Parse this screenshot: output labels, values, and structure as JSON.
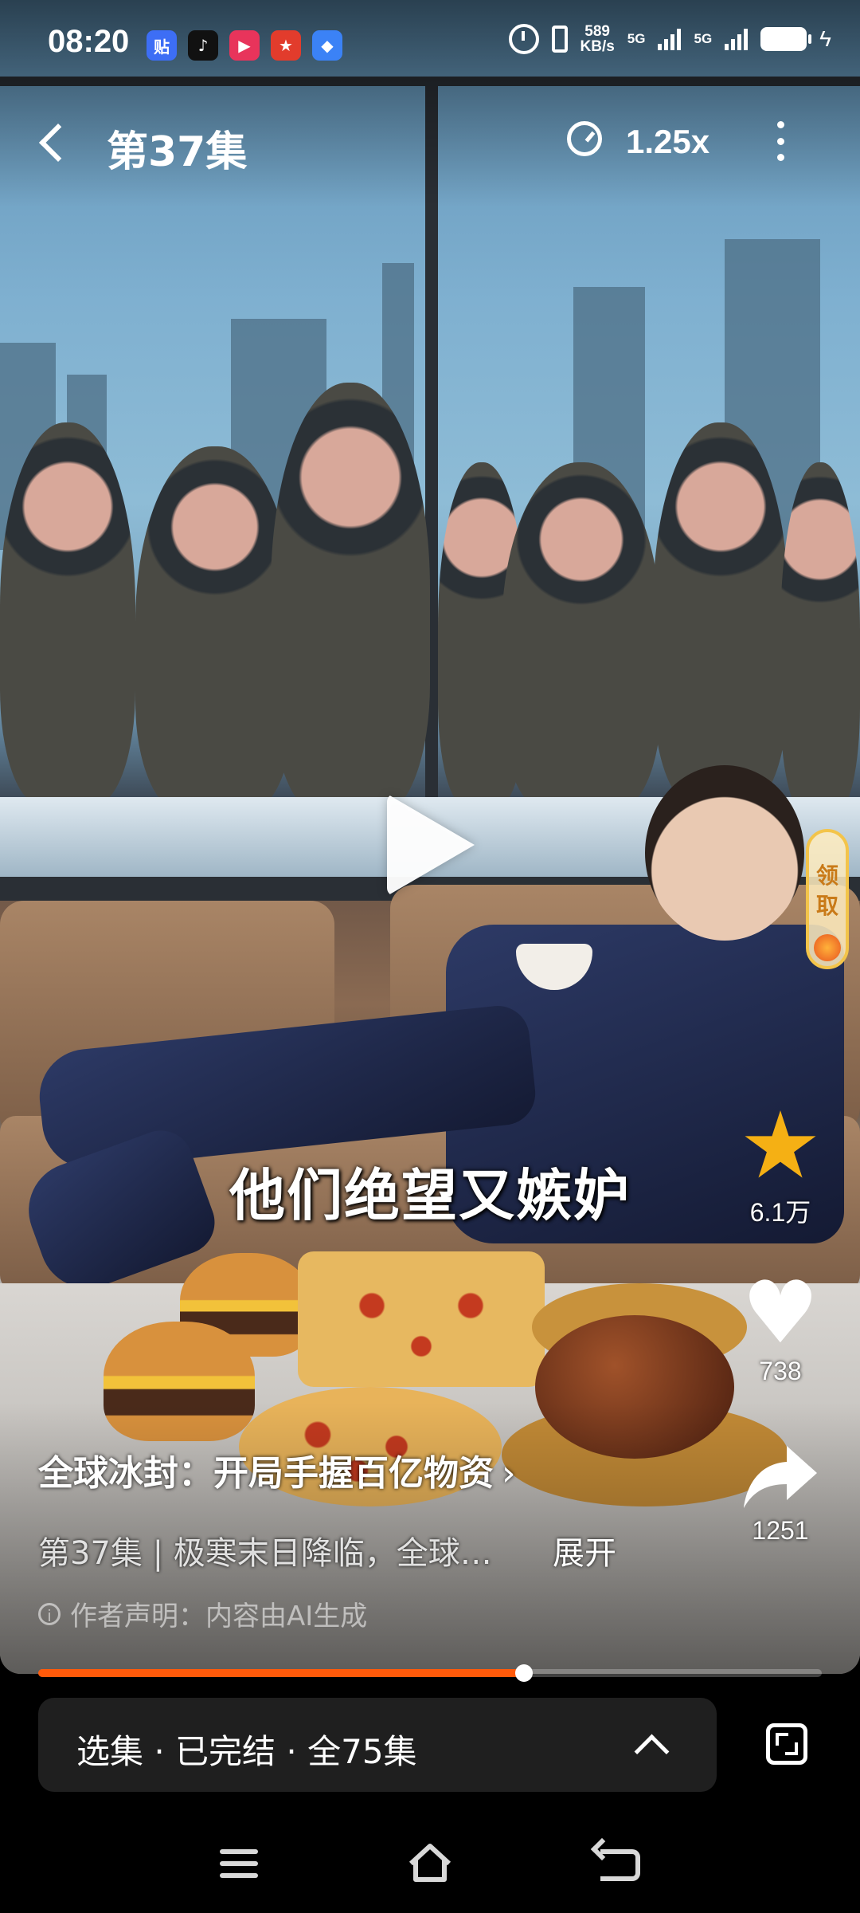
{
  "status_bar": {
    "time": "08:20",
    "apps": [
      {
        "icon": "tieba-icon",
        "label": "贴",
        "color": "#3d6ef5"
      },
      {
        "icon": "tiktok-icon",
        "label": "♪",
        "color": "#111111"
      },
      {
        "icon": "video-app-icon",
        "label": "▶",
        "color": "#e8345b"
      },
      {
        "icon": "game-app-icon",
        "label": "★",
        "color": "#e23c2c"
      },
      {
        "icon": "browser-app-icon",
        "label": "◆",
        "color": "#3b82f6"
      }
    ],
    "speed_value": "589",
    "speed_unit": "KB/s",
    "net1": "5G",
    "net2": "5G"
  },
  "player": {
    "episode_title": "第37集",
    "speed": "1.25x",
    "subtitle": "他们绝望又嫉妒",
    "reward": "领取"
  },
  "actions": {
    "favorite_count": "6.1万",
    "like_count": "738",
    "share_count": "1251"
  },
  "info": {
    "show_title": "全球冰封：开局手握百亿物资",
    "show_title_arrow": "›",
    "episode_desc": "第37集 | 极寒末日降临，全球…",
    "expand_label": "展开",
    "notice_icon_glyph": "i",
    "notice": "作者声明：内容由AI生成"
  },
  "progress": {
    "fraction": 0.62
  },
  "episode_bar": {
    "label": "选集 · 已完结 · 全75集"
  },
  "colors": {
    "accent": "#ff5a0a",
    "favorite": "#f5b014",
    "reward_border": "#f3c44a"
  }
}
